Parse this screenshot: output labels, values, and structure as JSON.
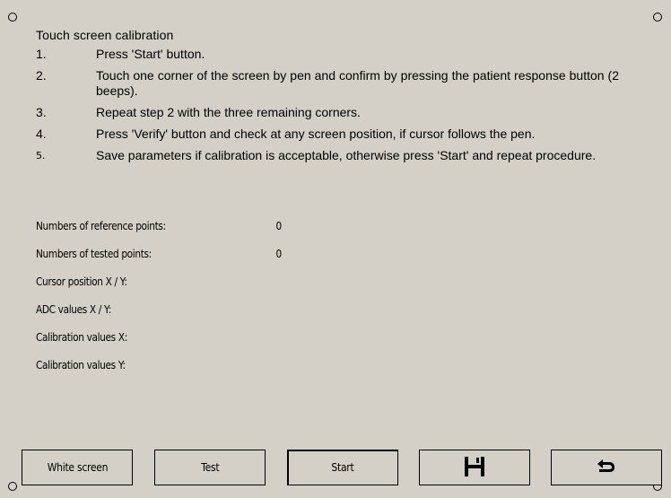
{
  "page": {
    "title": "Touch screen calibration"
  },
  "steps": [
    {
      "num": "1.",
      "text": "Press 'Start' button."
    },
    {
      "num": "2.",
      "text": "Touch one corner of the screen by pen and confirm by pressing the patient response button (2 beeps)."
    },
    {
      "num": "3.",
      "text": "Repeat step 2 with the three remaining corners."
    },
    {
      "num": "4.",
      "text": "Press 'Verify' button and check at any screen position, if cursor follows the pen."
    },
    {
      "num": "5.",
      "text": "Save parameters if calibration is acceptable, otherwise press 'Start' and repeat procedure."
    }
  ],
  "info": {
    "reference_points": {
      "label": "Numbers of reference points:",
      "value": "0"
    },
    "tested_points": {
      "label": "Numbers of tested points:",
      "value": "0"
    },
    "cursor_position": {
      "label": "Cursor position X / Y:",
      "value": ""
    },
    "adc_values": {
      "label": "ADC values X / Y:",
      "value": ""
    },
    "calibration_x": {
      "label": "Calibration values X:",
      "value": ""
    },
    "calibration_y": {
      "label": "Calibration values Y:",
      "value": ""
    }
  },
  "buttons": {
    "white_screen": "White screen",
    "test": "Test",
    "start": "Start",
    "save_icon": "floppy-disk-icon",
    "back_icon": "return-arrow-icon"
  }
}
